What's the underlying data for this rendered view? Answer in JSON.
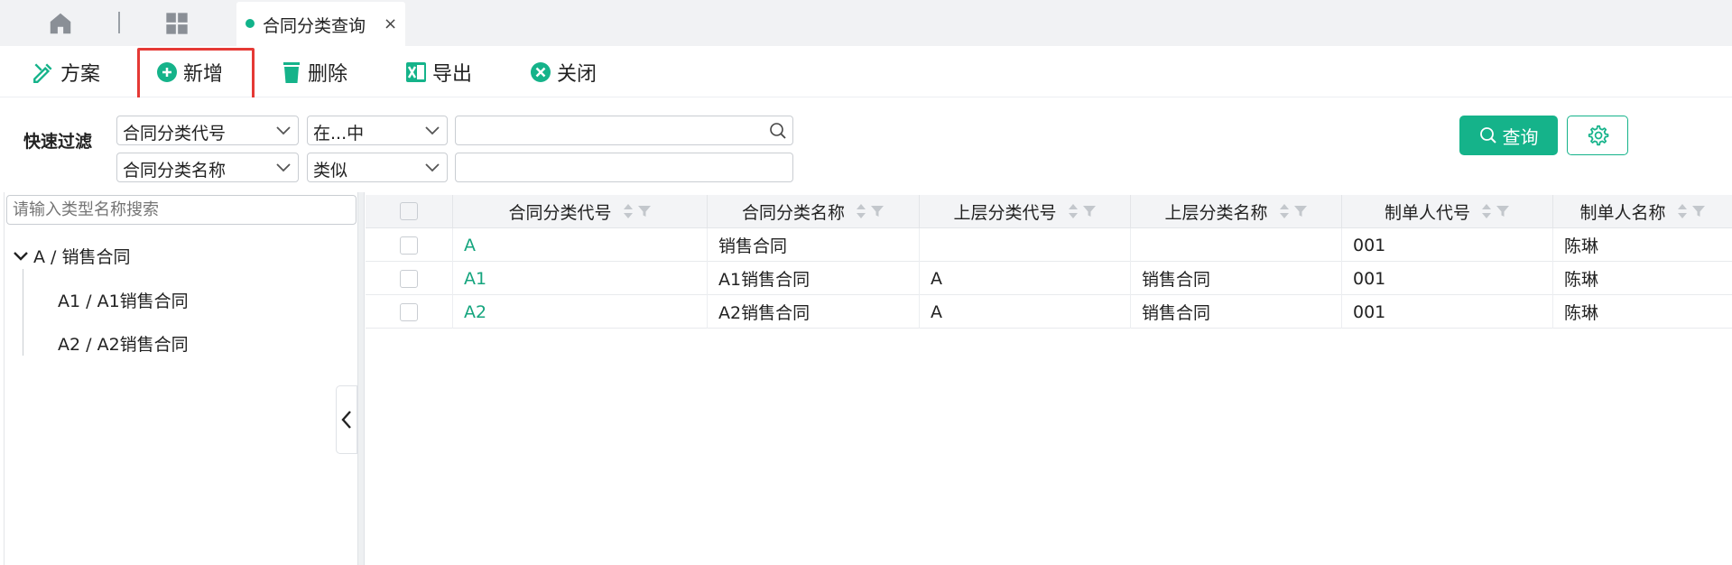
{
  "tabs": {
    "home_icon": "home-icon",
    "apps_icon": "grid-icon",
    "active_tab_label": "合同分类查询",
    "close_symbol": "×"
  },
  "toolbar": {
    "scheme": "方案",
    "add": "新增",
    "delete": "删除",
    "export": "导出",
    "close": "关闭"
  },
  "filter": {
    "title": "快速过滤",
    "row1_field": "合同分类代号",
    "row1_op": "在...中",
    "row1_value": "",
    "row2_field": "合同分类名称",
    "row2_op": "类似",
    "row2_value": "",
    "query_label": "查询"
  },
  "tree": {
    "search_placeholder": "请输入类型名称搜索",
    "root": "A / 销售合同",
    "children": [
      "A1 / A1销售合同",
      "A2 / A2销售合同"
    ]
  },
  "grid": {
    "headers": [
      "合同分类代号",
      "合同分类名称",
      "上层分类代号",
      "上层分类名称",
      "制单人代号",
      "制单人名称"
    ],
    "rows": [
      [
        "A",
        "销售合同",
        "",
        "",
        "001",
        "陈琳"
      ],
      [
        "A1",
        "A1销售合同",
        "A",
        "销售合同",
        "001",
        "陈琳"
      ],
      [
        "A2",
        "A2销售合同",
        "A",
        "销售合同",
        "001",
        "陈琳"
      ]
    ]
  },
  "colors": {
    "accent": "#15b38a",
    "highlight": "#e53935"
  }
}
